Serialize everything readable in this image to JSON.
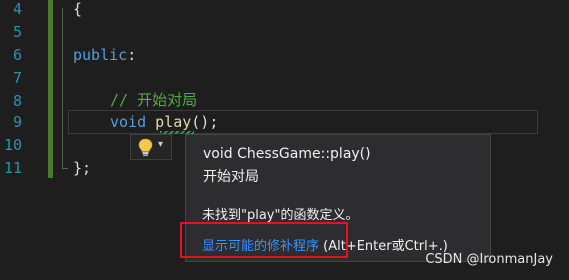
{
  "editor": {
    "line_numbers": [
      "4",
      "5",
      "6",
      "7",
      "8",
      "9",
      "10",
      "11"
    ],
    "lines": {
      "l4": "{",
      "l6_kw": "public",
      "l6_rest": ":",
      "l8_comment": "// 开始对局",
      "l9_kw": "void",
      "l9_space": " ",
      "l9_fn": "play",
      "l9_rest": "();",
      "l11": "};"
    }
  },
  "quick_info": {
    "signature": "void ChessGame::play()",
    "doc": "开始对局",
    "error": "未找到\"play\"的函数定义。",
    "fix_link": "显示可能的修补程序",
    "fix_shortcut": " (Alt+Enter或Ctrl+.)"
  },
  "lightbulb": {
    "icon": "lightbulb-icon",
    "caret": "▾"
  },
  "watermark": "CSDN @IronmanJay",
  "colors": {
    "background": "#1e1e1e",
    "keyword": "#569cd6",
    "comment": "#57a64a",
    "function": "#dcdcaa",
    "line_number": "#2b91af",
    "link": "#3794ff",
    "highlight_box": "#e81123"
  }
}
